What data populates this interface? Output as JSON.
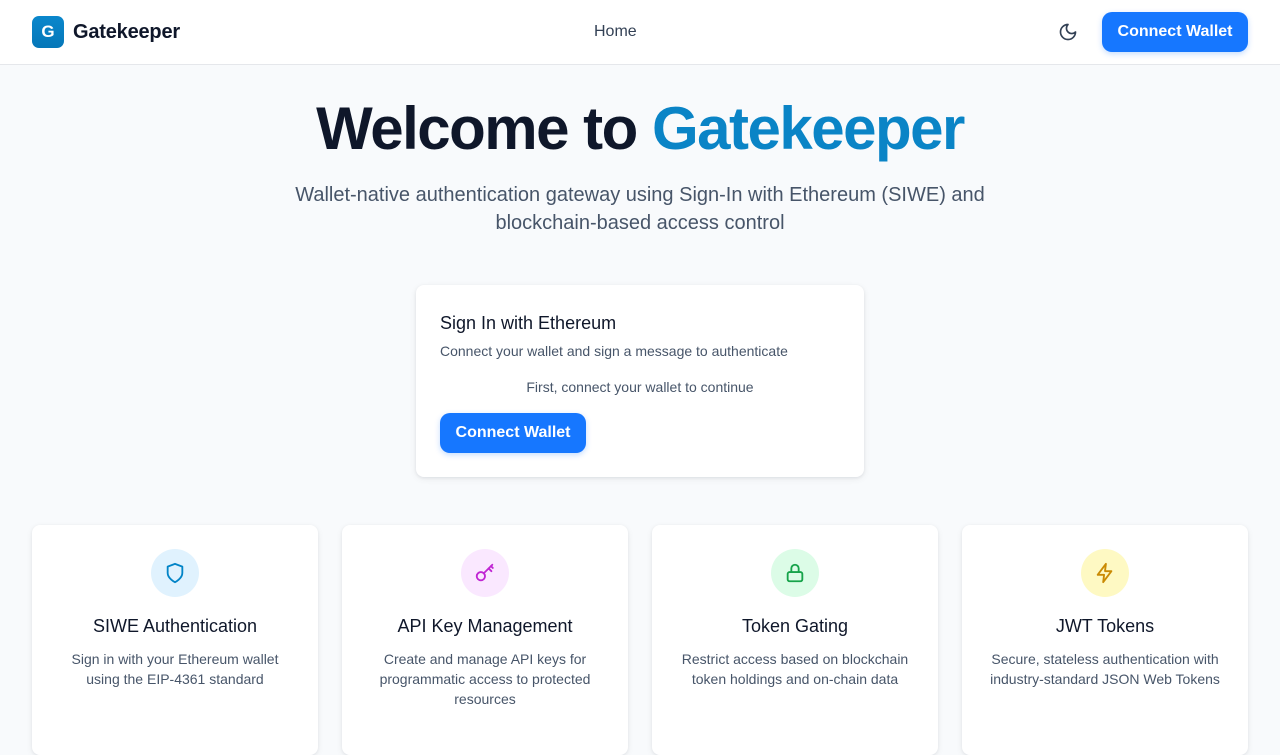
{
  "header": {
    "logo_letter": "G",
    "logo_text": "Gatekeeper",
    "nav_home": "Home",
    "connect_label": "Connect Wallet",
    "theme_icon": "moon-icon"
  },
  "hero": {
    "title_prefix": "Welcome to",
    "title_accent": "Gatekeeper",
    "subtitle": "Wallet-native authentication gateway using Sign-In with Ethereum (SIWE) and blockchain-based access control"
  },
  "signin": {
    "title": "Sign In with Ethereum",
    "description": "Connect your wallet and sign a message to authenticate",
    "note": "First, connect your wallet to continue",
    "connect_label": "Connect Wallet"
  },
  "features": [
    {
      "icon": "shield-icon",
      "title": "SIWE Authentication",
      "description": "Sign in with your Ethereum wallet using the EIP-4361 standard",
      "icon_bg": "#e0f2fe",
      "icon_color": "#0284c7"
    },
    {
      "icon": "key-icon",
      "title": "API Key Management",
      "description": "Create and manage API keys for programmatic access to protected resources",
      "icon_bg": "#fae8ff",
      "icon_color": "#c026d3"
    },
    {
      "icon": "lock-icon",
      "title": "Token Gating",
      "description": "Restrict access based on blockchain token holdings and on-chain data",
      "icon_bg": "#dcfce7",
      "icon_color": "#16a34a"
    },
    {
      "icon": "lightning-icon",
      "title": "JWT Tokens",
      "description": "Secure, stateless authentication with industry-standard JSON Web Tokens",
      "icon_bg": "#fef9c3",
      "icon_color": "#ca8a04"
    }
  ],
  "colors": {
    "primary": "#1677ff",
    "brand": "#0a84c6",
    "background": "#f8fafc"
  }
}
